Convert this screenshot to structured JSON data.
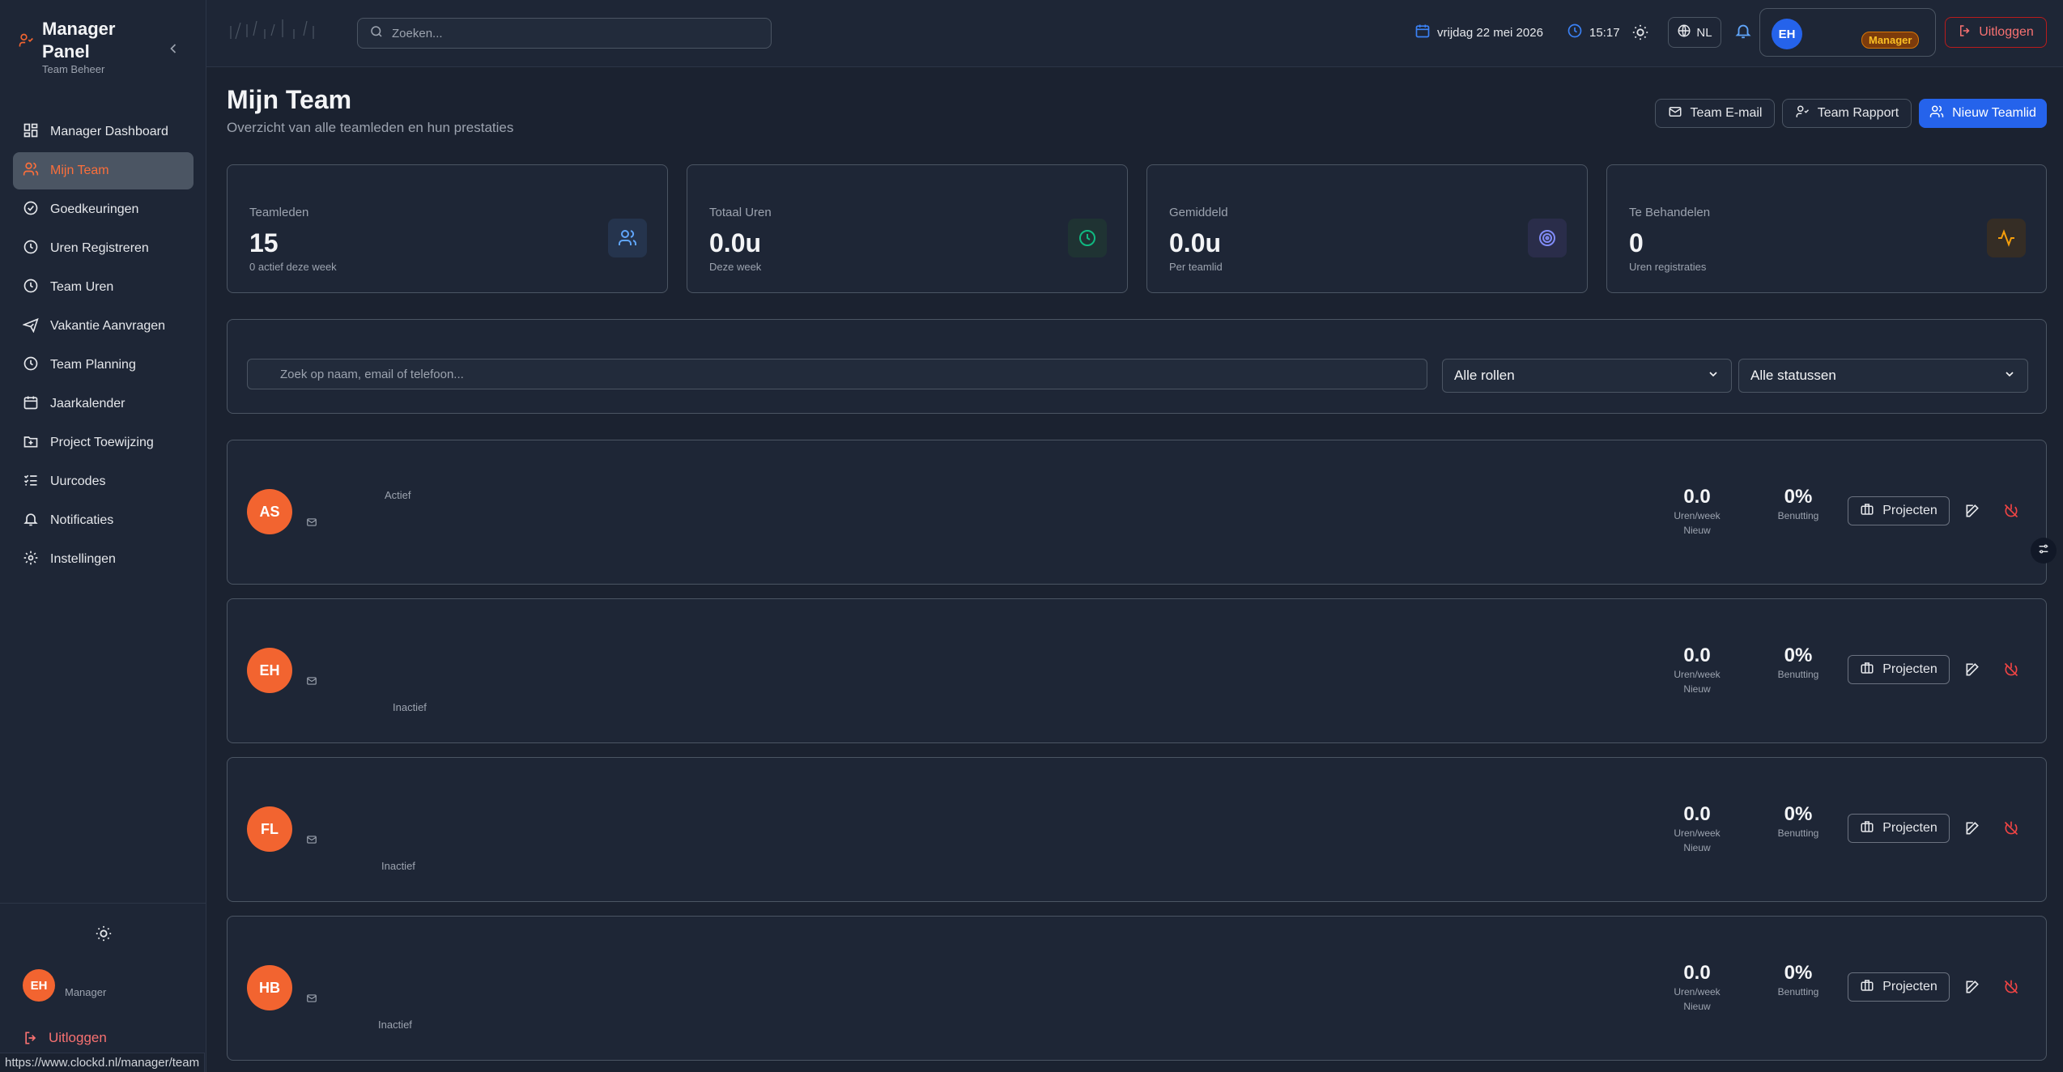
{
  "sidebar": {
    "title": "Manager Panel",
    "subtitle": "Team Beheer",
    "items": [
      {
        "label": "Manager Dashboard",
        "icon": "dashboard-icon"
      },
      {
        "label": "Mijn Team",
        "icon": "users-icon",
        "active": true
      },
      {
        "label": "Goedkeuringen",
        "icon": "check-circle-icon"
      },
      {
        "label": "Uren Registreren",
        "icon": "clock-icon"
      },
      {
        "label": "Team Uren",
        "icon": "clock-icon"
      },
      {
        "label": "Vakantie Aanvragen",
        "icon": "plane-icon"
      },
      {
        "label": "Team Planning",
        "icon": "clock-icon"
      },
      {
        "label": "Jaarkalender",
        "icon": "calendar-icon"
      },
      {
        "label": "Project Toewijzing",
        "icon": "folder-icon"
      },
      {
        "label": "Uurcodes",
        "icon": "list-check-icon"
      },
      {
        "label": "Notificaties",
        "icon": "bell-icon"
      },
      {
        "label": "Instellingen",
        "icon": "gear-icon"
      }
    ],
    "user": {
      "initials": "EH",
      "role": "Manager"
    },
    "logout": "Uitloggen"
  },
  "status_url": "https://www.clockd.nl/manager/team",
  "topbar": {
    "search_placeholder": "Zoeken...",
    "date": "vrijdag 22 mei 2026",
    "time": "15:17",
    "lang": "NL",
    "user_initials": "EH",
    "role_badge": "Manager",
    "logout": "Uitloggen"
  },
  "page": {
    "title": "Mijn Team",
    "subtitle": "Overzicht van alle teamleden en hun prestaties",
    "buttons": {
      "email": "Team E-mail",
      "report": "Team Rapport",
      "new": "Nieuw Teamlid"
    }
  },
  "stats": [
    {
      "label": "Teamleden",
      "value": "15",
      "note": "0 actief deze week",
      "color": "#60a5fa"
    },
    {
      "label": "Totaal Uren",
      "value": "0.0u",
      "note": "Deze week",
      "color": "#10b981"
    },
    {
      "label": "Gemiddeld",
      "value": "0.0u",
      "note": "Per teamlid",
      "color": "#818cf8"
    },
    {
      "label": "Te Behandelen",
      "value": "0",
      "note": "Uren registraties",
      "color": "#f59e0b"
    }
  ],
  "filters": {
    "search_placeholder": "Zoek op naam, email of telefoon...",
    "role": "Alle rollen",
    "status": "Alle statussen"
  },
  "members": [
    {
      "initials": "AS",
      "status": "Actief",
      "hours": "0.0",
      "hours_label": "Uren/week",
      "hours_note": "Nieuw",
      "util": "0%",
      "util_label": "Benutting",
      "projects": "Projecten"
    },
    {
      "initials": "EH",
      "status": "Inactief",
      "hours": "0.0",
      "hours_label": "Uren/week",
      "hours_note": "Nieuw",
      "util": "0%",
      "util_label": "Benutting",
      "projects": "Projecten"
    },
    {
      "initials": "FL",
      "status": "Inactief",
      "hours": "0.0",
      "hours_label": "Uren/week",
      "hours_note": "Nieuw",
      "util": "0%",
      "util_label": "Benutting",
      "projects": "Projecten"
    },
    {
      "initials": "HB",
      "status": "Inactief",
      "hours": "0.0",
      "hours_label": "Uren/week",
      "hours_note": "Nieuw",
      "util": "0%",
      "util_label": "Benutting",
      "projects": "Projecten"
    }
  ]
}
